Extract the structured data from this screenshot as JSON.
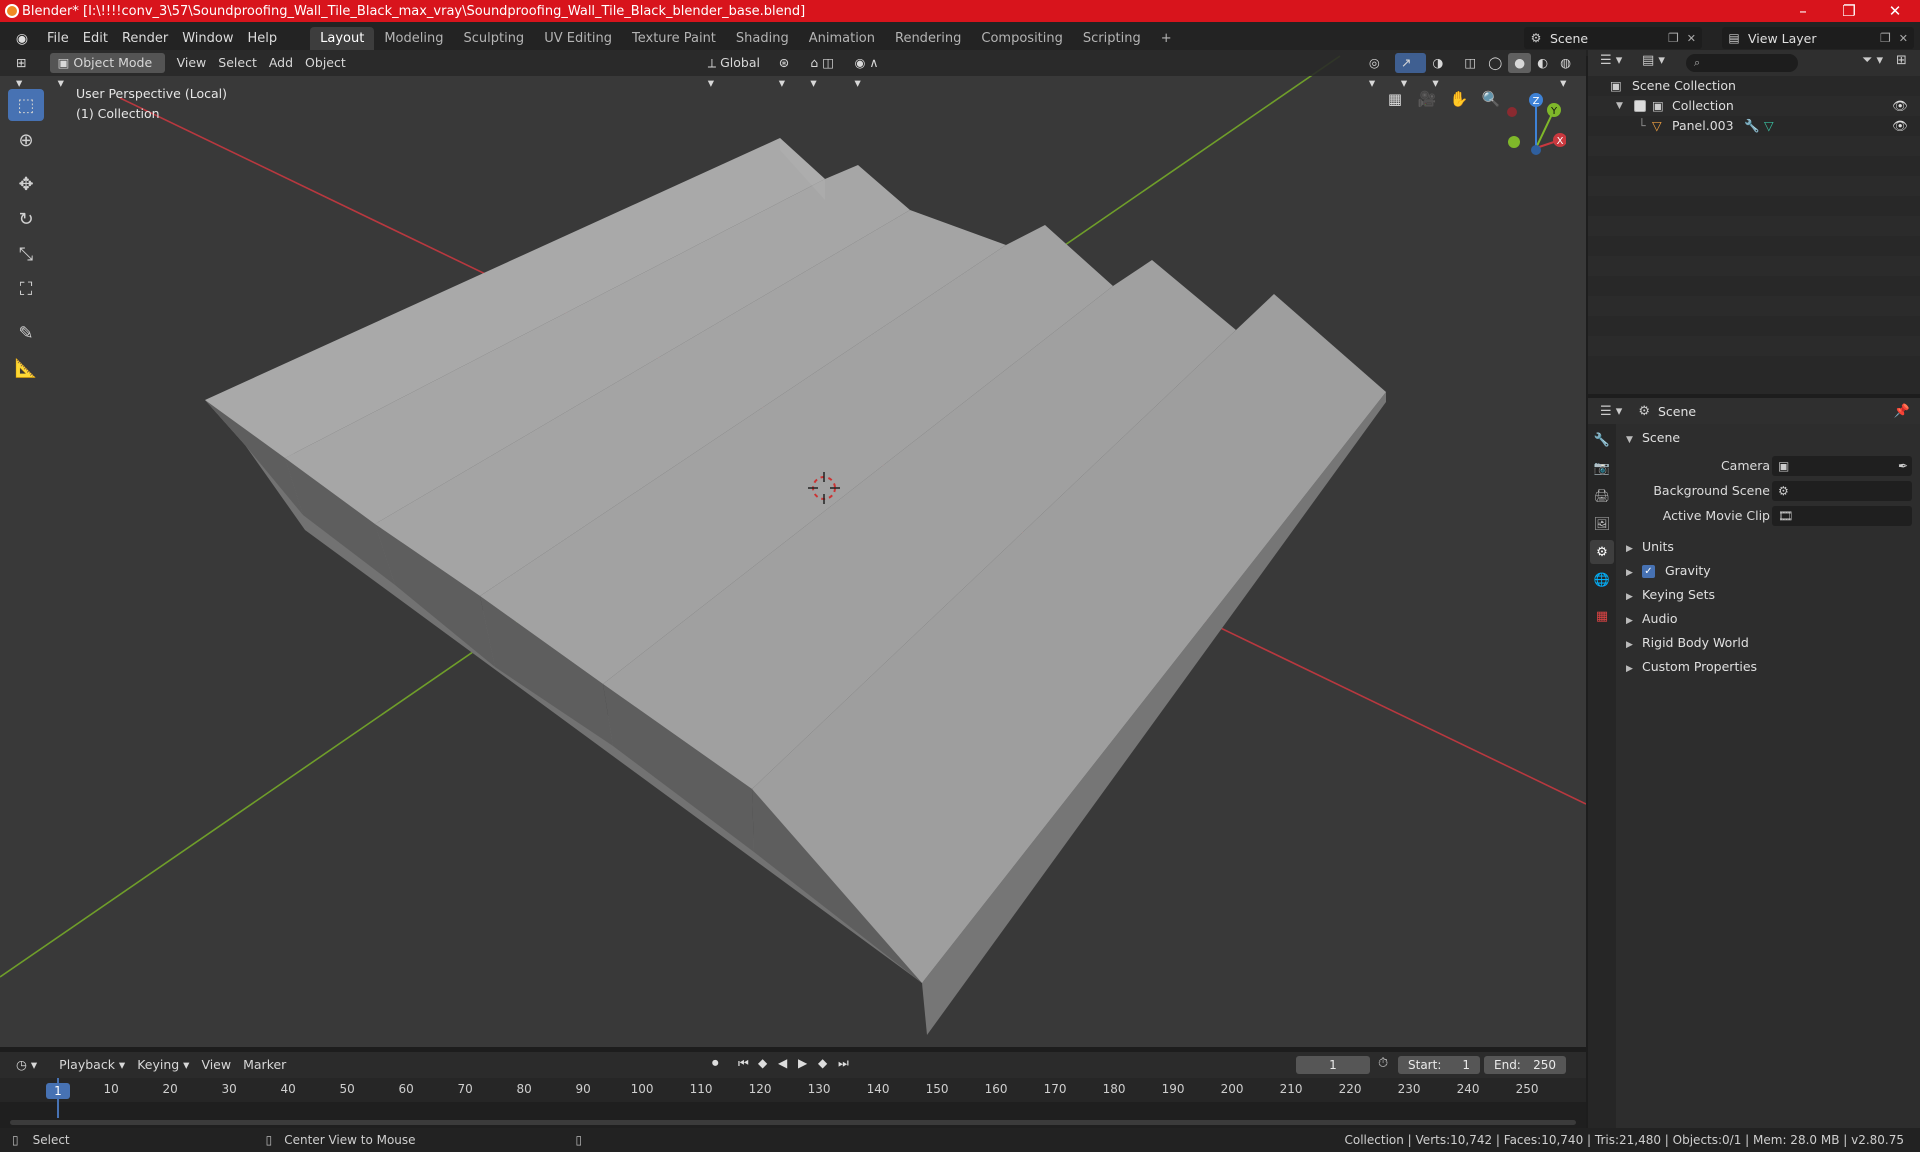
{
  "window": {
    "title": "Blender* [I:\\!!!!conv_3\\57\\Soundproofing_Wall_Tile_Black_max_vray\\Soundproofing_Wall_Tile_Black_blender_base.blend]",
    "minimize": "–",
    "maximize": "❐",
    "close": "✕"
  },
  "menus": [
    "File",
    "Edit",
    "Render",
    "Window",
    "Help"
  ],
  "workspaces": [
    "Layout",
    "Modeling",
    "Sculpting",
    "UV Editing",
    "Texture Paint",
    "Shading",
    "Animation",
    "Rendering",
    "Compositing",
    "Scripting"
  ],
  "add_workspace": "+",
  "scene_selector": {
    "label": "Scene"
  },
  "view_layer_selector": {
    "label": "View Layer"
  },
  "viewport_header": {
    "mode": "Object Mode",
    "view": "View",
    "select": "Select",
    "add": "Add",
    "object": "Object",
    "orientation": "Global"
  },
  "viewport_overlay": {
    "perspective": "User Perspective (Local)",
    "collection": "(1) Collection"
  },
  "gizmo": {
    "x": "X",
    "y": "Y",
    "z": "Z"
  },
  "outliner": {
    "root": "Scene Collection",
    "collection": "Collection",
    "object": "Panel.003"
  },
  "properties": {
    "header": "Scene",
    "section": "Scene",
    "camera_label": "Camera",
    "background_scene_label": "Background Scene",
    "active_movie_clip_label": "Active Movie Clip",
    "panels": [
      "Units",
      "Gravity",
      "Keying Sets",
      "Audio",
      "Rigid Body World",
      "Custom Properties"
    ]
  },
  "timeline": {
    "playback": "Playback",
    "keying": "Keying",
    "view": "View",
    "marker": "Marker",
    "current_frame": "1",
    "start_label": "Start:",
    "start": "1",
    "end_label": "End:",
    "end": "250",
    "ticks": [
      "1",
      "10",
      "20",
      "30",
      "40",
      "50",
      "60",
      "70",
      "80",
      "90",
      "100",
      "110",
      "120",
      "130",
      "140",
      "150",
      "160",
      "170",
      "180",
      "190",
      "200",
      "210",
      "220",
      "230",
      "240",
      "250"
    ]
  },
  "status": {
    "select": "Select",
    "center_view": "Center View to Mouse",
    "stats": "Collection | Verts:10,742 | Faces:10,740 | Tris:21,480 | Objects:0/1 | Mem: 28.0 MB | v2.80.75"
  },
  "colors": {
    "titlebar": "#d8141c",
    "accent": "#4772b3",
    "x_axis": "#c9393f",
    "y_axis": "#7fb82a",
    "z_axis": "#3e82d6"
  }
}
